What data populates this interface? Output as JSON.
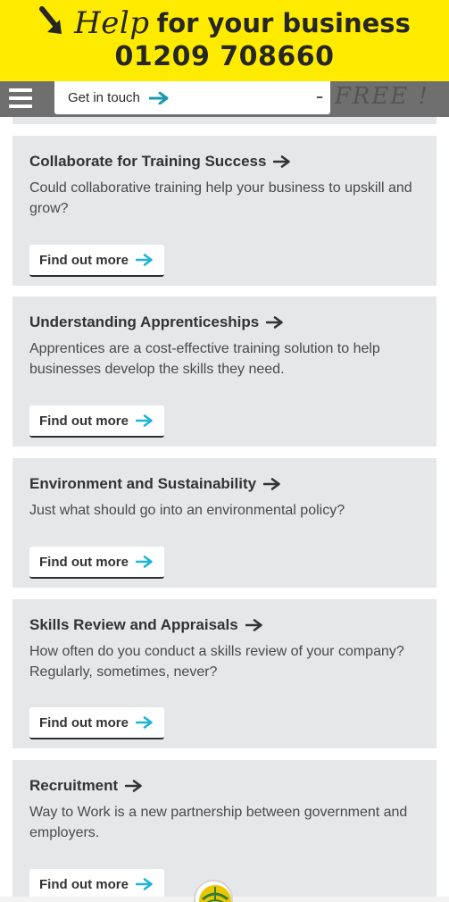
{
  "banner": {
    "help_word": "Help",
    "tagline": "for your business",
    "phone": "01209 708660",
    "background_color": "#ffeb00"
  },
  "nav": {
    "menu_icon": "hamburger-menu-icon",
    "cta_label": "Get in touch",
    "free_text": "- FREE !"
  },
  "cards": [
    {
      "title": "Collaborate for Training Success",
      "description": "Could collaborative training help your business to upskill and grow?",
      "button_label": "Find out more"
    },
    {
      "title": "Understanding Apprenticeships",
      "description": "Apprentices are a cost-effective training solution to help businesses develop the skills they need.",
      "button_label": "Find out more"
    },
    {
      "title": "Environment and Sustainability",
      "description": "Just what should go into an environmental policy?",
      "button_label": "Find out more"
    },
    {
      "title": "Skills Review and Appraisals",
      "description": "How often do you conduct a skills review of your company? Regularly, sometimes, never?",
      "button_label": "Find out more"
    },
    {
      "title": "Recruitment",
      "description": "Way to Work is a new partnership between government and employers.",
      "button_label": "Find out more"
    }
  ],
  "colors": {
    "accent_arrow": "#1fb4d6",
    "card_background": "#e6e7e9",
    "nav_background": "#6f6f6f"
  }
}
